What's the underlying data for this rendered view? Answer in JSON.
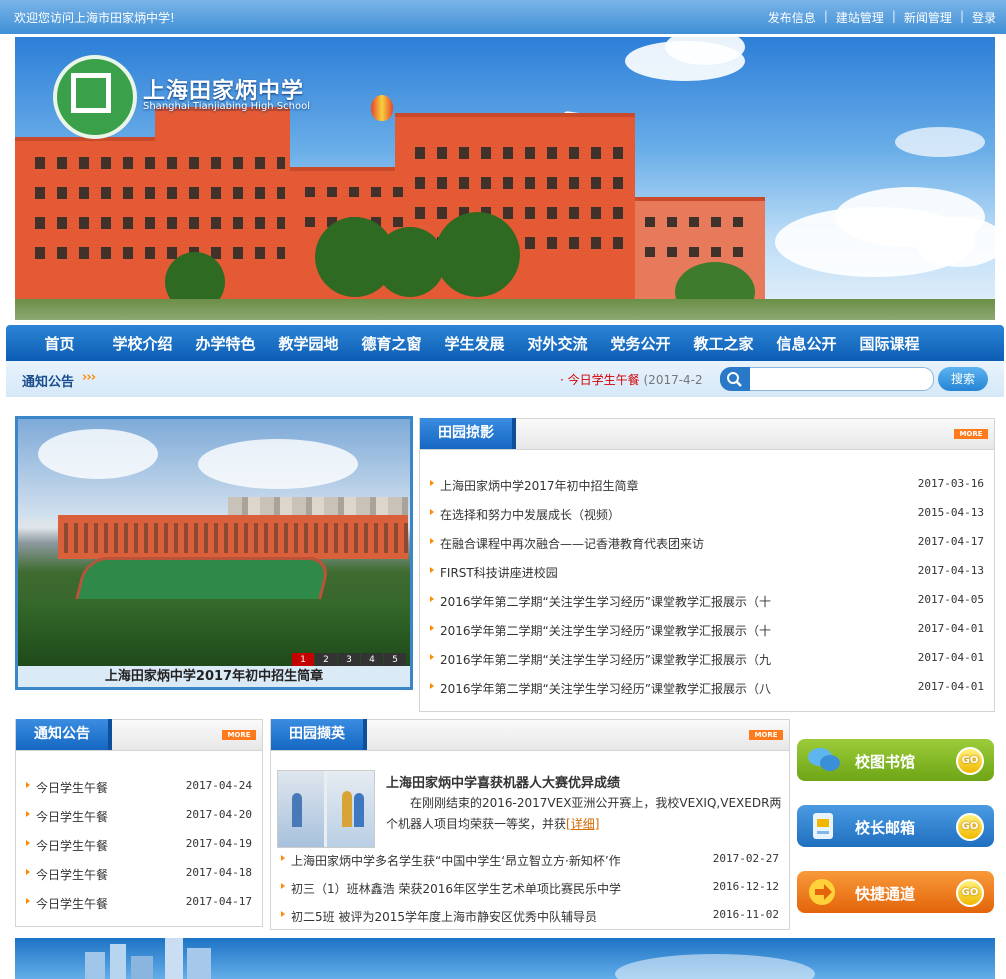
{
  "topbar": {
    "welcome": "欢迎您访问上海市田家炳中学!",
    "links": [
      "发布信息",
      "建站管理",
      "新闻管理",
      "登录"
    ]
  },
  "banner": {
    "title": "上海田家炳中学",
    "subtitle": "Shanghai Tianjiabing High School"
  },
  "nav": [
    "首页",
    "学校介绍",
    "办学特色",
    "教学园地",
    "德育之窗",
    "学生发展",
    "对外交流",
    "党务公开",
    "教工之家",
    "信息公开",
    "国际课程"
  ],
  "strip": {
    "label": "通知公告",
    "arrows": "›››",
    "ticker_title": "今日学生午餐",
    "ticker_date": "(2017-4-2",
    "search_placeholder": "",
    "search_button": "搜索"
  },
  "photo": {
    "caption": "上海田家炳中学2017年初中招生简章",
    "pages": [
      "1",
      "2",
      "3",
      "4",
      "5"
    ],
    "active_page": 1
  },
  "campus_photos": {
    "title": "田园掠影",
    "more": "MORE",
    "items": [
      {
        "title": "上海田家炳中学2017年初中招生简章",
        "date": "2017-03-16"
      },
      {
        "title": "在选择和努力中发展成长（视频）",
        "date": "2015-04-13"
      },
      {
        "title": "在融合课程中再次融合——记香港教育代表团来访",
        "date": "2017-04-17"
      },
      {
        "title": "FIRST科技讲座进校园",
        "date": "2017-04-13"
      },
      {
        "title": "2016学年第二学期“关注学生学习经历”课堂教学汇报展示（十",
        "date": "2017-04-05"
      },
      {
        "title": "2016学年第二学期“关注学生学习经历”课堂教学汇报展示（十",
        "date": "2017-04-01"
      },
      {
        "title": "2016学年第二学期“关注学生学习经历”课堂教学汇报展示（九",
        "date": "2017-04-01"
      },
      {
        "title": "2016学年第二学期“关注学生学习经历”课堂教学汇报展示（八",
        "date": "2017-04-01"
      }
    ]
  },
  "notices": {
    "title": "通知公告",
    "more": "MORE",
    "items": [
      {
        "title": "今日学生午餐",
        "date": "2017-04-24"
      },
      {
        "title": "今日学生午餐",
        "date": "2017-04-20"
      },
      {
        "title": "今日学生午餐",
        "date": "2017-04-19"
      },
      {
        "title": "今日学生午餐",
        "date": "2017-04-18"
      },
      {
        "title": "今日学生午餐",
        "date": "2017-04-17"
      }
    ]
  },
  "elites": {
    "title": "田园撷英",
    "more": "MORE",
    "feature_title": "上海田家炳中学喜获机器人大赛优异成绩",
    "feature_text": "在刚刚结束的2016-2017VEX亚洲公开赛上，我校VEXIQ,VEXEDR两个机器人项目均荣获一等奖，并获",
    "feature_link": "[详细]",
    "items": [
      {
        "title": "上海田家炳中学多名学生获“中国中学生‘昂立智立方·新知杯’作",
        "date": "2017-02-27"
      },
      {
        "title": "初三（1）班林鑫浩 荣获2016年区学生艺术单项比赛民乐中学",
        "date": "2016-12-12"
      },
      {
        "title": "初二5班 被评为2015学年度上海市静安区优秀中队辅导员",
        "date": "2016-11-02"
      }
    ]
  },
  "quick": [
    {
      "label": "校图书馆",
      "go": "GO",
      "color": "#7cb51a",
      "icon": "speech-bubbles-icon"
    },
    {
      "label": "校长邮箱",
      "go": "GO",
      "color": "#2b82cf",
      "icon": "mailbox-icon"
    },
    {
      "label": "快捷通道",
      "go": "GO",
      "color": "#f0730e",
      "icon": "arrow-right-icon"
    }
  ]
}
